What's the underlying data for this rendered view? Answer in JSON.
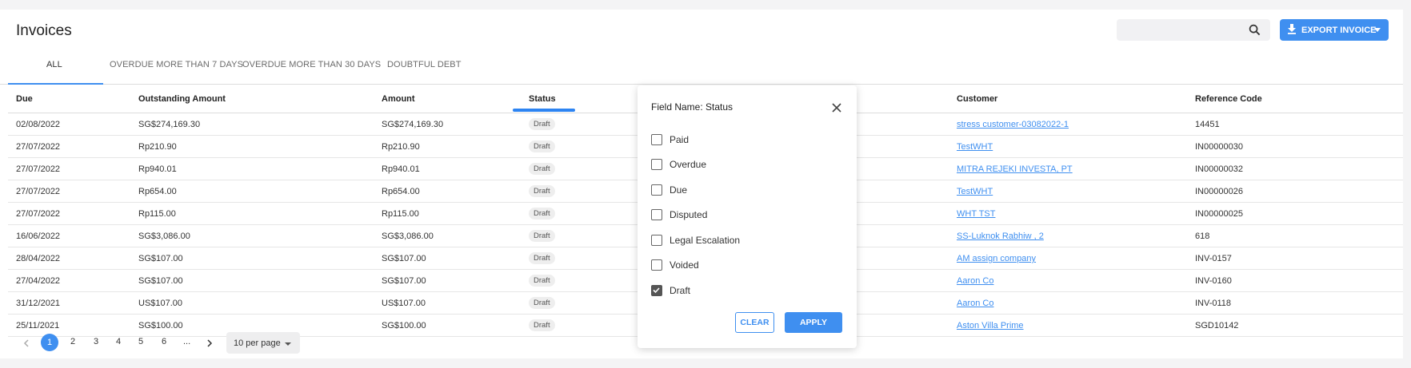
{
  "header": {
    "title": "Invoices",
    "search": {
      "value": "",
      "placeholder": ""
    },
    "export_label": "EXPORT INVOICE"
  },
  "tabs": [
    {
      "label": "ALL",
      "active": true
    },
    {
      "label": "OVERDUE MORE THAN 7 DAYS",
      "active": false
    },
    {
      "label": "OVERDUE MORE THAN 30 DAYS",
      "active": false
    },
    {
      "label": "DOUBTFUL DEBT",
      "active": false
    }
  ],
  "table": {
    "columns": [
      "Due",
      "Outstanding Amount",
      "Amount",
      "Status",
      "Customer",
      "Reference Code"
    ],
    "rows": [
      {
        "due": "02/08/2022",
        "outstanding": "SG$274,169.30",
        "amount": "SG$274,169.30",
        "status": "Draft",
        "customer": "stress customer-03082022-1",
        "ref": "14451"
      },
      {
        "due": "27/07/2022",
        "outstanding": "Rp210.90",
        "amount": "Rp210.90",
        "status": "Draft",
        "customer": "TestWHT",
        "ref": "IN00000030"
      },
      {
        "due": "27/07/2022",
        "outstanding": "Rp940.01",
        "amount": "Rp940.01",
        "status": "Draft",
        "customer": "MITRA REJEKI INVESTA, PT",
        "ref": "IN00000032"
      },
      {
        "due": "27/07/2022",
        "outstanding": "Rp654.00",
        "amount": "Rp654.00",
        "status": "Draft",
        "customer": "TestWHT",
        "ref": "IN00000026"
      },
      {
        "due": "27/07/2022",
        "outstanding": "Rp115.00",
        "amount": "Rp115.00",
        "status": "Draft",
        "customer": "WHT TST",
        "ref": "IN00000025"
      },
      {
        "due": "16/06/2022",
        "outstanding": "SG$3,086.00",
        "amount": "SG$3,086.00",
        "status": "Draft",
        "customer": "SS-Luknok Rabhiw , 2",
        "ref": "618"
      },
      {
        "due": "28/04/2022",
        "outstanding": "SG$107.00",
        "amount": "SG$107.00",
        "status": "Draft",
        "customer": "AM assign company",
        "ref": "INV-0157"
      },
      {
        "due": "27/04/2022",
        "outstanding": "SG$107.00",
        "amount": "SG$107.00",
        "status": "Draft",
        "customer": "Aaron Co",
        "ref": "INV-0160"
      },
      {
        "due": "31/12/2021",
        "outstanding": "US$107.00",
        "amount": "US$107.00",
        "status": "Draft",
        "customer": "Aaron Co",
        "ref": "INV-0118"
      },
      {
        "due": "25/11/2021",
        "outstanding": "SG$100.00",
        "amount": "SG$100.00",
        "status": "Draft",
        "customer": "Aston Villa Prime",
        "ref": "SGD10142"
      }
    ]
  },
  "pagination": {
    "pages": [
      "1",
      "2",
      "3",
      "4",
      "5",
      "6",
      "..."
    ],
    "current": "1",
    "per_page_label": "10 per page"
  },
  "filter_popover": {
    "title": "Field Name: Status",
    "options": [
      {
        "label": "Paid",
        "checked": false
      },
      {
        "label": "Overdue",
        "checked": false
      },
      {
        "label": "Due",
        "checked": false
      },
      {
        "label": "Disputed",
        "checked": false
      },
      {
        "label": "Legal Escalation",
        "checked": false
      },
      {
        "label": "Voided",
        "checked": false
      },
      {
        "label": "Draft",
        "checked": true
      }
    ],
    "clear_label": "CLEAR",
    "apply_label": "APPLY"
  },
  "colors": {
    "accent": "#3f8ff0",
    "background": "#f4f4f5"
  },
  "icons": [
    "search-icon",
    "download-icon",
    "chevron-down-icon",
    "chevron-left-icon",
    "chevron-right-icon",
    "close-icon",
    "checkmark-icon"
  ]
}
